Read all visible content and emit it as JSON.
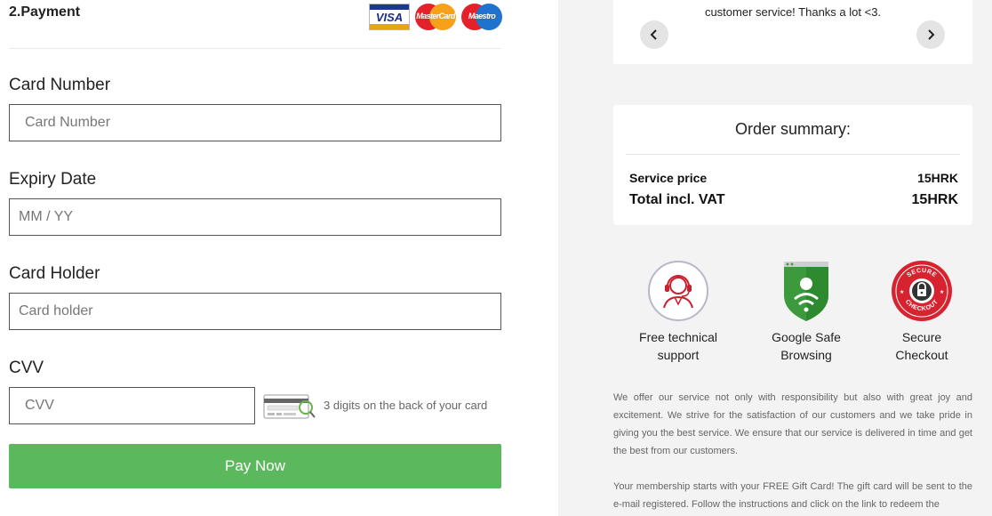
{
  "payment": {
    "section_title": "2.Payment",
    "logos": {
      "visa": "VISA",
      "mastercard": "MasterCard",
      "maestro": "Maestro"
    },
    "card_number": {
      "label": "Card Number",
      "placeholder": "Card Number"
    },
    "expiry": {
      "label": "Expiry Date",
      "placeholder": "MM / YY"
    },
    "holder": {
      "label": "Card Holder",
      "placeholder": "Card holder"
    },
    "cvv": {
      "label": "CVV",
      "placeholder": "CVV",
      "hint": "3 digits on the back of your card"
    },
    "pay_button": "Pay Now"
  },
  "sidebar": {
    "testimonial": {
      "text": "customer service! Thanks a lot <3."
    },
    "summary": {
      "title": "Order summary:",
      "rows": [
        {
          "label": "Service price",
          "value": "15HRK"
        },
        {
          "label": "Total incl. VAT",
          "value": "15HRK"
        }
      ]
    },
    "badges": [
      {
        "label": "Free technical\nsupport",
        "icon": "headset-support-icon"
      },
      {
        "label": "Google Safe\nBrowsing",
        "icon": "shield-wifi-icon"
      },
      {
        "label": "Secure\nCheckout",
        "icon": "lock-seal-icon"
      }
    ],
    "paragraphs": [
      "We offer our service not only with responsibility but also with great joy and excitement. We strive for the satisfaction of our customers and we take pride in giving you the best service. We ensure that our service is delivered in time and get the best from our customers.",
      "Your membership starts with your FREE Gift Card! The gift card will be sent to the e-mail registered. Follow the instructions and click on the link to redeem the"
    ]
  },
  "colors": {
    "pay_button": "#5cb85c",
    "sidebar_bg": "#f3f3f3",
    "secure_red": "#d7232f",
    "google_green": "#3c9a3c"
  }
}
